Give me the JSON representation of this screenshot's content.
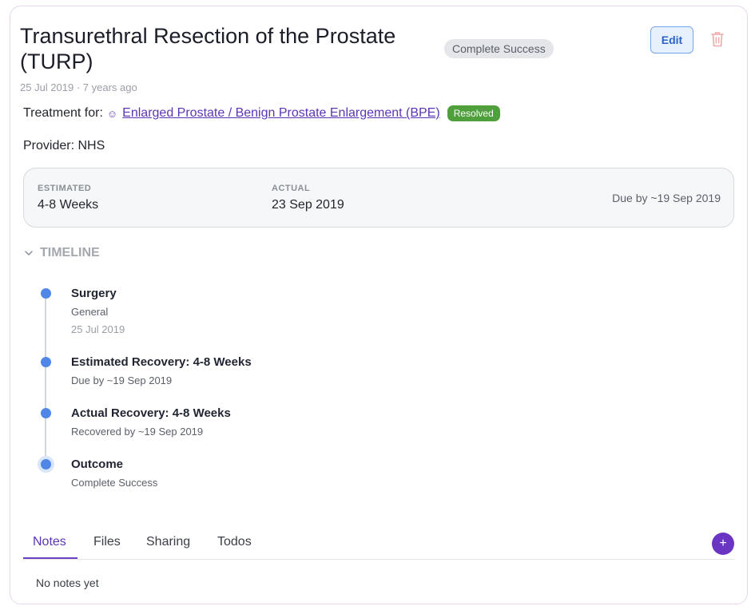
{
  "procedure": {
    "title": "Transurethral Resection of the Prostate (TURP)",
    "status_badge": "Complete Success",
    "date_text": "25 Jul 2019 · 7 years ago",
    "edit_label": "Edit",
    "delete_icon": "trash-icon"
  },
  "treatment": {
    "label": "Treatment for:",
    "condition_icon": "condition-icon",
    "condition_link": "Enlarged Prostate / Benign Prostate Enlargement (BPE)",
    "condition_status": "Resolved"
  },
  "provider": {
    "text": "Provider: NHS"
  },
  "recovery": {
    "estimated_label": "ESTIMATED",
    "estimated_value": "4-8 Weeks",
    "actual_label": "ACTUAL",
    "actual_value": "23 Sep 2019",
    "due_text": "Due by ~19 Sep 2019"
  },
  "timeline": {
    "heading": "TIMELINE",
    "events": [
      {
        "title": "Surgery",
        "subtitle": "General",
        "date": "25 Jul 2019"
      },
      {
        "title": "Estimated Recovery: 4-8 Weeks",
        "subtitle": "Due by ~19 Sep 2019"
      },
      {
        "title": "Actual Recovery: 4-8 Weeks",
        "subtitle": "Recovered by ~19 Sep 2019"
      },
      {
        "title": "Outcome",
        "subtitle": "Complete Success"
      }
    ]
  },
  "tabs": {
    "items": [
      {
        "label": "Notes"
      },
      {
        "label": "Files"
      },
      {
        "label": "Sharing"
      },
      {
        "label": "Todos"
      }
    ],
    "active": "Notes",
    "add_icon": "plus-icon"
  },
  "notes": {
    "empty_text": "No notes yet"
  },
  "colors": {
    "accent": "#6b35c4",
    "link": "#5b35b5",
    "timeline_dot": "#4f86e8",
    "resolved_badge": "#4f9f3c",
    "edit_border": "#7ba6e6"
  }
}
